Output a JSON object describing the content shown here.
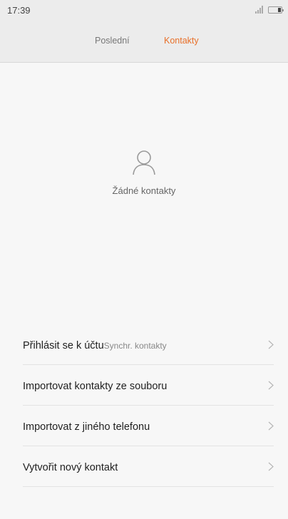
{
  "status_bar": {
    "time": "17:39",
    "signal_icon": "signal-icon",
    "battery_icon": "battery-icon"
  },
  "tabs": [
    {
      "label": "Poslední",
      "active": false
    },
    {
      "label": "Kontakty",
      "active": true
    }
  ],
  "colors": {
    "accent": "#e8702a",
    "background": "#f7f7f7",
    "header": "#ececec"
  },
  "empty_state": {
    "icon": "person-icon",
    "label": "Žádné kontakty"
  },
  "actions": [
    {
      "label": "Přihlásit se k účtu",
      "sublabel": "Synchr. kontakty",
      "icon": "chevron-right-icon"
    },
    {
      "label": "Importovat kontakty ze souboru",
      "icon": "chevron-right-icon"
    },
    {
      "label": "Importovat z jiného telefonu",
      "icon": "chevron-right-icon"
    },
    {
      "label": "Vytvořit nový kontakt",
      "icon": "chevron-right-icon"
    }
  ]
}
